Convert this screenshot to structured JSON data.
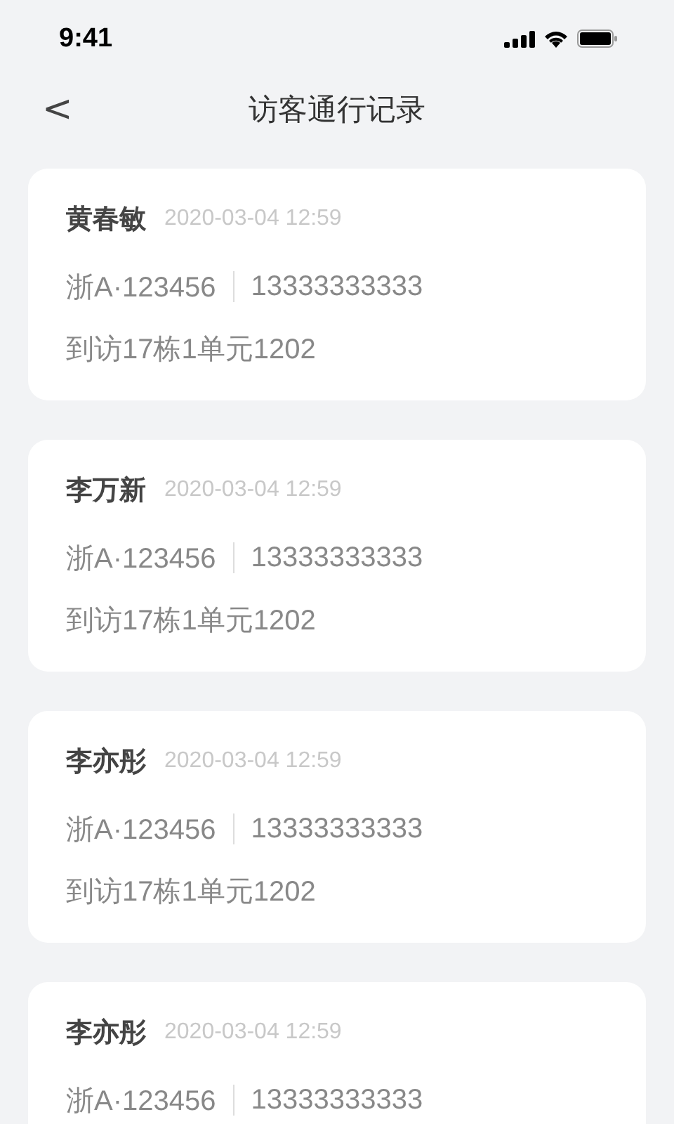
{
  "status_bar": {
    "time": "9:41"
  },
  "nav": {
    "back": "<",
    "title": "访客通行记录"
  },
  "records": [
    {
      "name": "黄春敏",
      "time": "2020-03-04 12:59",
      "plate": "浙A·123456",
      "phone": "13333333333",
      "visit": "到访17栋1单元1202"
    },
    {
      "name": "李万新",
      "time": "2020-03-04 12:59",
      "plate": "浙A·123456",
      "phone": "13333333333",
      "visit": "到访17栋1单元1202"
    },
    {
      "name": "李亦彤",
      "time": "2020-03-04 12:59",
      "plate": "浙A·123456",
      "phone": "13333333333",
      "visit": "到访17栋1单元1202"
    },
    {
      "name": "李亦彤",
      "time": "2020-03-04 12:59",
      "plate": "浙A·123456",
      "phone": "13333333333"
    }
  ]
}
